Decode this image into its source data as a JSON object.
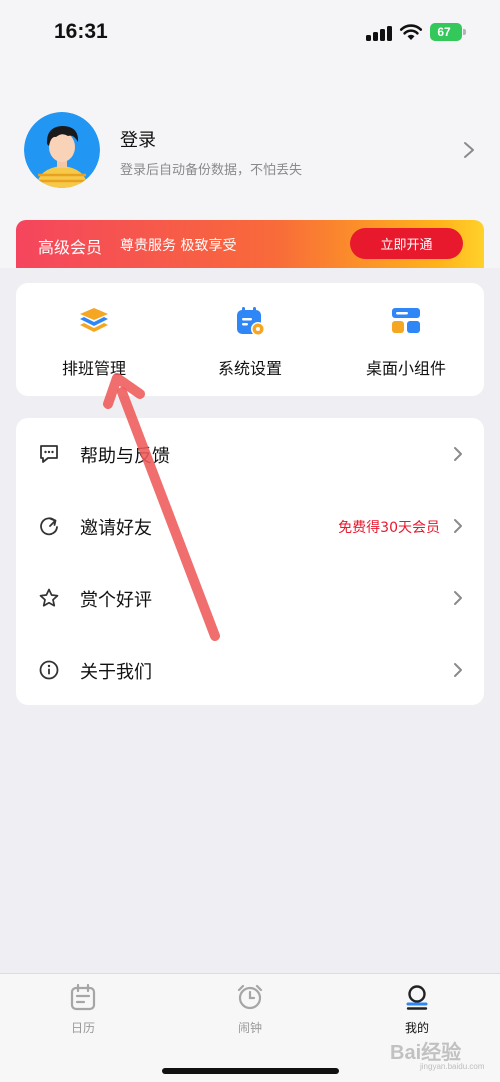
{
  "status_bar": {
    "time": "16:31",
    "battery": "67"
  },
  "profile": {
    "title": "登录",
    "subtitle": "登录后自动备份数据，不怕丢失"
  },
  "vip": {
    "title": "高级会员",
    "description": "尊贵服务 极致享受",
    "button": "立即开通"
  },
  "quick_actions": [
    {
      "label": "排班管理",
      "icon": "layers-icon"
    },
    {
      "label": "系统设置",
      "icon": "calendar-gear-icon"
    },
    {
      "label": "桌面小组件",
      "icon": "widget-icon"
    }
  ],
  "menu": [
    {
      "label": "帮助与反馈",
      "icon": "chat-bubble-icon",
      "extra": ""
    },
    {
      "label": "邀请好友",
      "icon": "refresh-icon",
      "extra": "免费得30天会员"
    },
    {
      "label": "赏个好评",
      "icon": "star-icon",
      "extra": ""
    },
    {
      "label": "关于我们",
      "icon": "info-icon",
      "extra": ""
    }
  ],
  "tabs": [
    {
      "label": "日历",
      "icon": "calendar-icon",
      "active": false
    },
    {
      "label": "闹钟",
      "icon": "alarm-icon",
      "active": false
    },
    {
      "label": "我的",
      "icon": "profile-icon",
      "active": true
    }
  ],
  "colors": {
    "vip_button": "#e8192c",
    "accent_red": "#e8192c",
    "quick_icon_blue": "#2f86f6",
    "quick_icon_orange": "#f5a623",
    "battery_green": "#34c759"
  },
  "watermark": {
    "main": "Bai经验",
    "sub": "jingyan.baidu.com"
  }
}
